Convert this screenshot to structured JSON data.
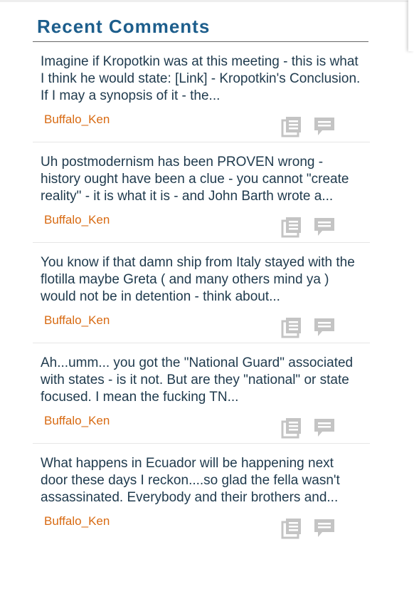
{
  "widget": {
    "title": "Recent Comments"
  },
  "comments": [
    {
      "text": "Imagine if Kropotkin was at this meeting - this is what I think he would state: [Link] - Kropotkin's Conclusion. If I may a synopsis of it - the...",
      "author": "Buffalo_Ken"
    },
    {
      "text": "Uh postmodernism has been PROVEN wrong - history ought have been a clue - you cannot \"create reality\" - it is what it is - and John Barth wrote a...",
      "author": "Buffalo_Ken"
    },
    {
      "text": "You know if that damn ship from Italy stayed with the flotilla maybe Greta ( and many others mind ya ) would not be in detention - think about...",
      "author": "Buffalo_Ken"
    },
    {
      "text": "Ah...umm... you got the \"National Guard\" associated with states - is it not. But are they \"national\" or state focused. I mean the fucking TN...",
      "author": "Buffalo_Ken"
    },
    {
      "text": "What happens in Ecuador will be happening next door these days I reckon....so glad the fella wasn't assassinated. Everybody and their brothers and...",
      "author": "Buffalo_Ken"
    }
  ],
  "icons": {
    "post": "article-icon",
    "reply": "comment-bubble-icon"
  },
  "colors": {
    "title": "#1d5e8c",
    "author": "#d86a12",
    "text": "#1f3a4d",
    "icon": "#c4c4c4"
  }
}
